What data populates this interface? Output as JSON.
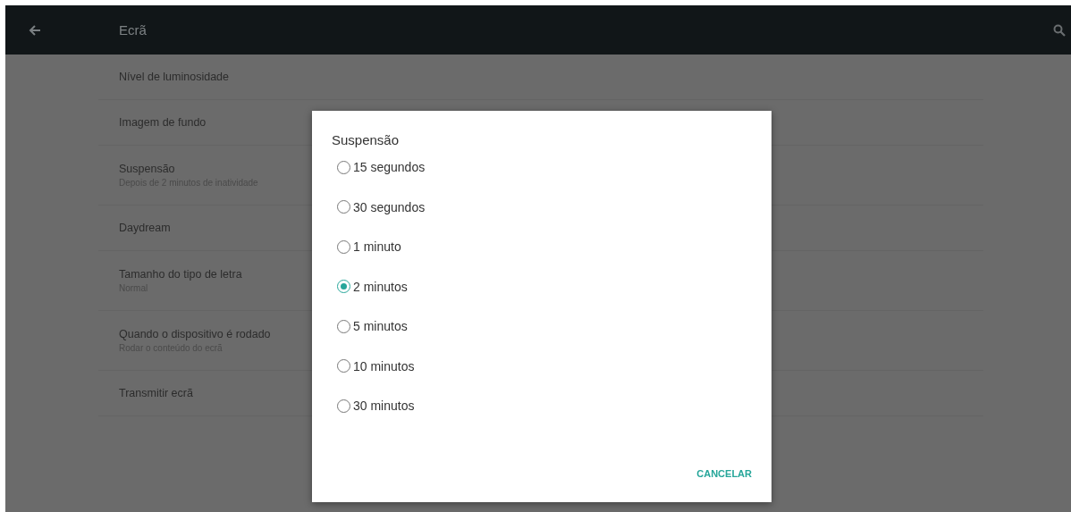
{
  "app_bar": {
    "title": "Ecrã"
  },
  "settings": [
    {
      "title": "Nível de luminosidade"
    },
    {
      "title": "Imagem de fundo"
    },
    {
      "title": "Suspensão",
      "summary": "Depois de 2 minutos de inatividade"
    },
    {
      "title": "Daydream"
    },
    {
      "title": "Tamanho do tipo de letra",
      "summary": "Normal"
    },
    {
      "title": "Quando o dispositivo é rodado",
      "summary": "Rodar o conteúdo do ecrã"
    },
    {
      "title": "Transmitir ecrã"
    }
  ],
  "dialog": {
    "title": "Suspensão",
    "options": [
      {
        "label": "15 segundos",
        "selected": false
      },
      {
        "label": "30 segundos",
        "selected": false
      },
      {
        "label": "1 minuto",
        "selected": false
      },
      {
        "label": "2 minutos",
        "selected": true
      },
      {
        "label": "5 minutos",
        "selected": false
      },
      {
        "label": "10 minutos",
        "selected": false
      },
      {
        "label": "30 minutos",
        "selected": false
      }
    ],
    "buttons": [
      "CANCELAR"
    ]
  }
}
